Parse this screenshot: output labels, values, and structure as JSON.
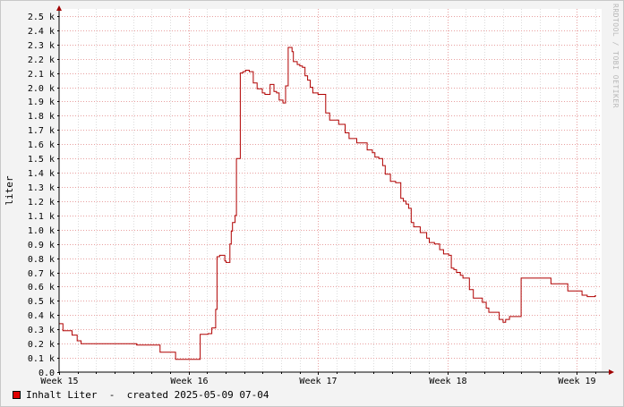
{
  "chart_data": {
    "type": "line",
    "ylabel": "liter",
    "ylim": [
      0,
      2550
    ],
    "y_ticks": [
      {
        "v": 0,
        "label": "0.0"
      },
      {
        "v": 100,
        "label": "0.1 k"
      },
      {
        "v": 200,
        "label": "0.2 k"
      },
      {
        "v": 300,
        "label": "0.3 k"
      },
      {
        "v": 400,
        "label": "0.4 k"
      },
      {
        "v": 500,
        "label": "0.5 k"
      },
      {
        "v": 600,
        "label": "0.6 k"
      },
      {
        "v": 700,
        "label": "0.7 k"
      },
      {
        "v": 800,
        "label": "0.8 k"
      },
      {
        "v": 900,
        "label": "0.9 k"
      },
      {
        "v": 1000,
        "label": "1.0 k"
      },
      {
        "v": 1100,
        "label": "1.1 k"
      },
      {
        "v": 1200,
        "label": "1.2 k"
      },
      {
        "v": 1300,
        "label": "1.3 k"
      },
      {
        "v": 1400,
        "label": "1.4 k"
      },
      {
        "v": 1500,
        "label": "1.5 k"
      },
      {
        "v": 1600,
        "label": "1.6 k"
      },
      {
        "v": 1700,
        "label": "1.7 k"
      },
      {
        "v": 1800,
        "label": "1.8 k"
      },
      {
        "v": 1900,
        "label": "1.9 k"
      },
      {
        "v": 2000,
        "label": "2.0 k"
      },
      {
        "v": 2100,
        "label": "2.1 k"
      },
      {
        "v": 2200,
        "label": "2.2 k"
      },
      {
        "v": 2300,
        "label": "2.3 k"
      },
      {
        "v": 2400,
        "label": "2.4 k"
      },
      {
        "v": 2500,
        "label": "2.5 k"
      }
    ],
    "xlim": [
      15,
      19.15
    ],
    "x_ticks": [
      {
        "v": 15,
        "label": "Week 15"
      },
      {
        "v": 16,
        "label": "Week 16"
      },
      {
        "v": 17,
        "label": "Week 17"
      },
      {
        "v": 18,
        "label": "Week 18"
      },
      {
        "v": 19,
        "label": "Week 19"
      }
    ],
    "x_minor_step": 0.142857,
    "grid": true,
    "series": [
      {
        "name": "Inhalt Liter",
        "color": "#b00000",
        "step": true,
        "x": [
          15.0,
          15.03,
          15.1,
          15.14,
          15.17,
          15.6,
          15.78,
          15.9,
          16.0,
          16.09,
          16.12,
          16.15,
          16.18,
          16.21,
          16.22,
          16.24,
          16.28,
          16.29,
          16.32,
          16.33,
          16.34,
          16.36,
          16.37,
          16.4,
          16.42,
          16.44,
          16.47,
          16.5,
          16.53,
          16.57,
          16.59,
          16.63,
          16.66,
          16.68,
          16.7,
          16.73,
          16.75,
          16.77,
          16.8,
          16.81,
          16.84,
          16.86,
          16.88,
          16.9,
          16.92,
          16.94,
          16.96,
          17.0,
          17.03,
          17.06,
          17.09,
          17.16,
          17.21,
          17.24,
          17.3,
          17.38,
          17.42,
          17.44,
          17.47,
          17.5,
          17.52,
          17.56,
          17.6,
          17.64,
          17.66,
          17.68,
          17.7,
          17.72,
          17.74,
          17.79,
          17.84,
          17.86,
          17.9,
          17.94,
          17.97,
          18.01,
          18.03,
          18.05,
          18.07,
          18.1,
          18.12,
          18.17,
          18.2,
          18.27,
          18.3,
          18.32,
          18.4,
          18.43,
          18.45,
          18.48,
          18.51,
          18.57,
          18.73,
          18.76,
          18.8,
          18.93,
          19.02,
          19.04,
          19.08,
          19.12,
          19.14
        ],
        "values": [
          340,
          290,
          260,
          220,
          200,
          190,
          140,
          90,
          90,
          265,
          265,
          270,
          310,
          440,
          810,
          820,
          780,
          770,
          900,
          990,
          1050,
          1100,
          1500,
          2100,
          2110,
          2120,
          2110,
          2030,
          1990,
          1960,
          1950,
          2020,
          1970,
          1960,
          1910,
          1890,
          2010,
          2280,
          2250,
          2180,
          2160,
          2150,
          2140,
          2080,
          2050,
          2000,
          1960,
          1950,
          1950,
          1820,
          1770,
          1740,
          1680,
          1640,
          1610,
          1560,
          1540,
          1510,
          1500,
          1450,
          1390,
          1340,
          1330,
          1220,
          1200,
          1180,
          1150,
          1050,
          1020,
          980,
          940,
          910,
          900,
          860,
          830,
          820,
          730,
          720,
          700,
          680,
          660,
          580,
          520,
          490,
          450,
          420,
          370,
          350,
          370,
          390,
          390,
          660,
          660,
          660,
          620,
          570,
          570,
          540,
          530,
          530,
          535
        ]
      }
    ],
    "legend": {
      "position": "bottom-left",
      "label": "Inhalt Liter",
      "created": "  -  created 2025-05-09 07-04"
    },
    "watermark": "RRDTOOL / TOBI OETIKER"
  }
}
